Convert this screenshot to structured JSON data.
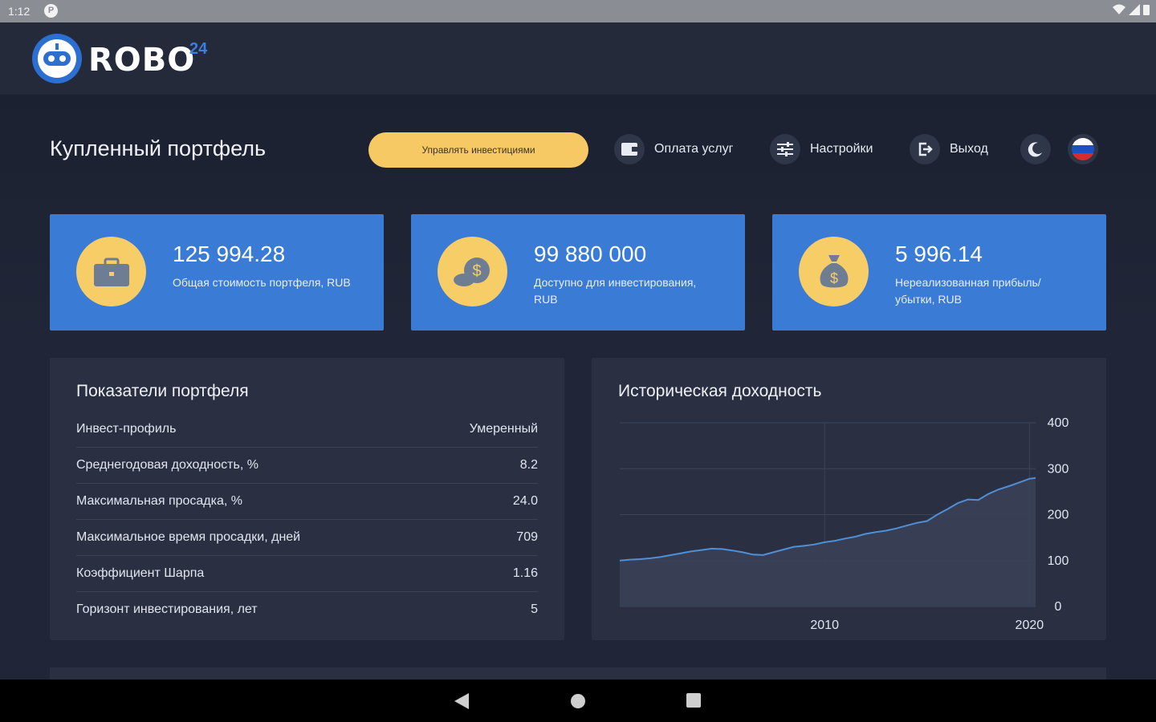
{
  "status_bar": {
    "time": "1:12"
  },
  "app": {
    "logo_text": "ROBO",
    "logo_suffix": "24"
  },
  "header": {
    "page_title": "Купленный портфель",
    "manage_button": "Управлять инвестициями",
    "nav": [
      {
        "icon": "wallet-icon",
        "label": "Оплата услуг"
      },
      {
        "icon": "settings-sliders-icon",
        "label": "Настройки"
      },
      {
        "icon": "logout-icon",
        "label": "Выход"
      }
    ]
  },
  "stats": [
    {
      "icon": "briefcase-icon",
      "value": "125 994.28",
      "label": "Общая стоимость портфеля, RUB"
    },
    {
      "icon": "coins-dollar-icon",
      "value": "99 880 000",
      "label": "Доступно для инвестирования, RUB"
    },
    {
      "icon": "money-bag-icon",
      "value": "5 996.14",
      "label": "Нереализованная прибыль/убытки, RUB"
    }
  ],
  "metrics": {
    "title": "Показатели портфеля",
    "rows": [
      {
        "label": "Инвест-профиль",
        "value": "Умеренный"
      },
      {
        "label": "Среднегодовая доходность, %",
        "value": "8.2"
      },
      {
        "label": "Максимальная просадка, %",
        "value": "24.0"
      },
      {
        "label": "Максимальное время просадки, дней",
        "value": "709"
      },
      {
        "label": "Коэффициент Шарпа",
        "value": "1.16"
      },
      {
        "label": "Горизонт инвестирования, лет",
        "value": "5"
      }
    ]
  },
  "chart_data": {
    "type": "area",
    "title": "Историческая доходность",
    "x_tick_labels": [
      "2010",
      "2020"
    ],
    "y_tick_labels": [
      "0",
      "100",
      "200",
      "300",
      "400"
    ],
    "ylim": [
      0,
      400
    ],
    "xlim": [
      2000,
      2020.3
    ],
    "y_axis_position": "right",
    "grid": true,
    "series": [
      {
        "x": [
          2000.0,
          2000.5,
          2001.0,
          2001.5,
          2002.0,
          2002.5,
          2003.0,
          2003.5,
          2004.0,
          2004.5,
          2005.0,
          2005.5,
          2006.0,
          2006.5,
          2007.0,
          2007.5,
          2008.0,
          2008.5,
          2009.0,
          2009.5,
          2010.0,
          2010.5,
          2011.0,
          2011.5,
          2012.0,
          2012.5,
          2013.0,
          2013.5,
          2014.0,
          2014.5,
          2015.0,
          2015.5,
          2016.0,
          2016.5,
          2017.0,
          2017.5,
          2018.0,
          2018.5,
          2019.0,
          2019.5,
          2020.0,
          2020.3
        ],
        "values": [
          100,
          102,
          103,
          105,
          108,
          112,
          116,
          120,
          123,
          126,
          125,
          122,
          118,
          113,
          112,
          118,
          124,
          130,
          132,
          135,
          140,
          143,
          148,
          152,
          158,
          162,
          165,
          170,
          176,
          182,
          186,
          200,
          212,
          225,
          233,
          232,
          245,
          255,
          262,
          270,
          278,
          280
        ]
      }
    ]
  },
  "colors": {
    "accent_blue": "#3a7bd5",
    "yellow": "#f7c965",
    "chart_line": "#4f8fd6"
  }
}
